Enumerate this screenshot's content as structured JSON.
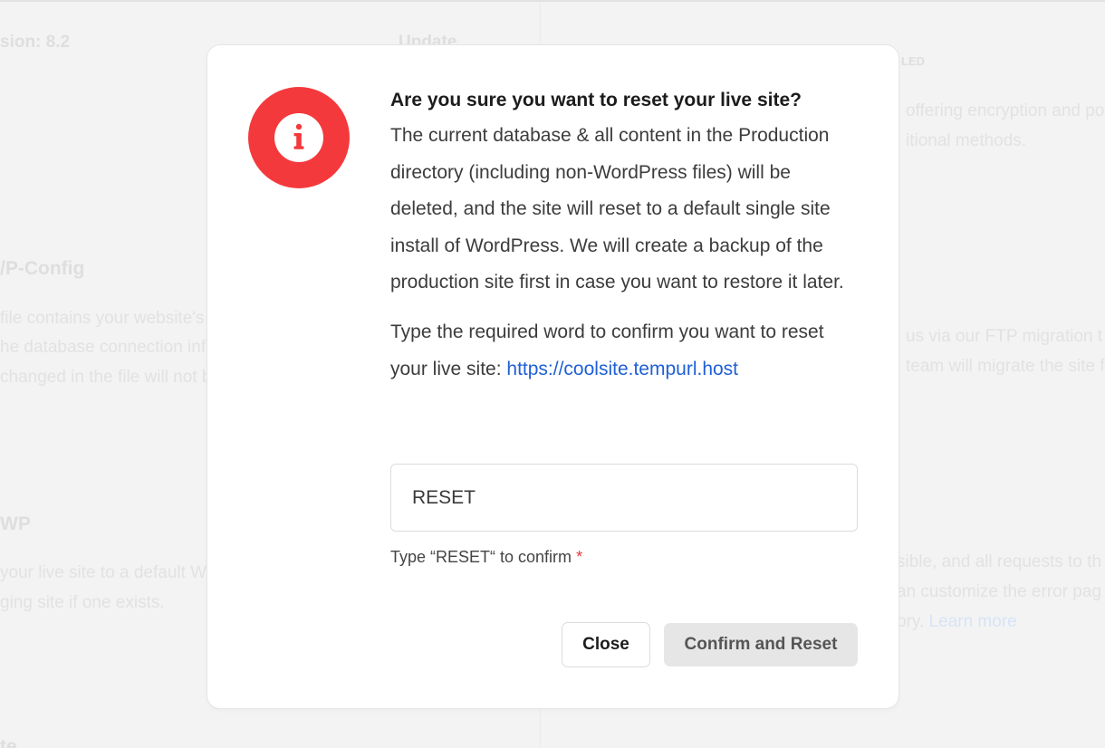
{
  "background": {
    "version_label": "sion: 8.2",
    "update_label": "Update",
    "enabled_label": "LED",
    "right_line1": "offering encryption and po",
    "right_line2": "itional methods.",
    "wpconfig_title": "/P-Config",
    "wpconfig_line1": "file contains your website's",
    "wpconfig_line2": "he database connection inf",
    "wpconfig_line3": "changed in the file will not b",
    "ftp_line1": "us via our FTP migration t",
    "ftp_line2": "team will migrate the site f",
    "reset_title": "WP",
    "reset_line1": "your live site to a default W",
    "reset_line2": "ging site if one exists.",
    "err_line1": "sible, and all requests to th",
    "err_line2": "an customize the error pag",
    "err_line3_prefix": "ory.",
    "learn_more": "Learn more",
    "bottom_fragment": "te"
  },
  "modal": {
    "title": "Are you sure you want to reset your live site?",
    "description": "The current database & all content in the Production directory (including non-WordPress files) will be deleted, and the site will reset to a default single site install of WordPress. We will create a backup of the production site first in case you want to restore it later.",
    "confirm_prompt": "Type the required word to confirm you want to reset your live site:",
    "site_url": "https://coolsite.tempurl.host",
    "input_value": "RESET",
    "helper_text": "Type “RESET“ to confirm",
    "required_mark": "*",
    "close_label": "Close",
    "confirm_label": "Confirm and Reset",
    "badge_color": "#f4393c",
    "link_color": "#1f5fd6"
  }
}
